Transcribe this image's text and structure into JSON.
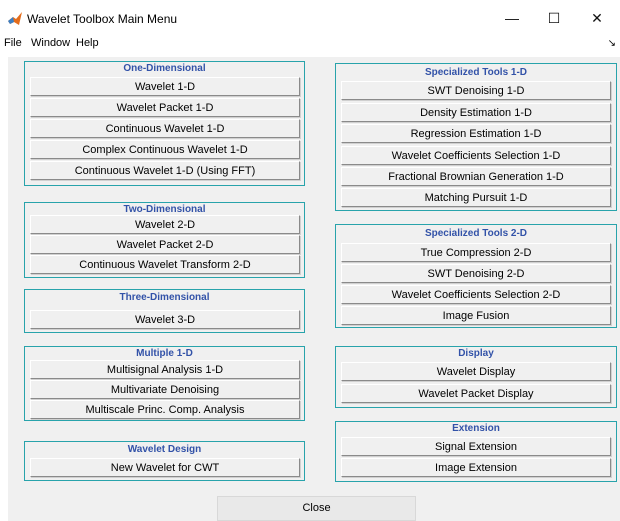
{
  "window": {
    "title": "Wavelet Toolbox Main Menu",
    "minimize_glyph": "—",
    "maximize_glyph": "☐",
    "close_glyph": "✕"
  },
  "menu": {
    "file": "File",
    "window": "Window",
    "help": "Help",
    "overflow_glyph": "↘"
  },
  "panels": {
    "one_dim": {
      "title": "One-Dimensional",
      "buttons": [
        "Wavelet 1-D",
        "Wavelet Packet 1-D",
        "Continuous Wavelet 1-D",
        "Complex Continuous Wavelet 1-D",
        "Continuous Wavelet 1-D (Using FFT)"
      ]
    },
    "two_dim": {
      "title": "Two-Dimensional",
      "buttons": [
        "Wavelet 2-D",
        "Wavelet Packet 2-D",
        "Continuous Wavelet Transform 2-D"
      ]
    },
    "three_dim": {
      "title": "Three-Dimensional",
      "buttons": [
        "Wavelet 3-D"
      ]
    },
    "multiple_1d": {
      "title": "Multiple 1-D",
      "buttons": [
        "Multisignal Analysis 1-D",
        "Multivariate Denoising",
        "Multiscale Princ. Comp. Analysis"
      ]
    },
    "wavelet_design": {
      "title": "Wavelet Design",
      "buttons": [
        "New Wavelet for CWT"
      ]
    },
    "spec_1d": {
      "title": "Specialized Tools 1-D",
      "buttons": [
        "SWT Denoising 1-D",
        "Density Estimation 1-D",
        "Regression Estimation 1-D",
        "Wavelet Coefficients Selection 1-D",
        "Fractional Brownian Generation 1-D",
        "Matching Pursuit 1-D"
      ]
    },
    "spec_2d": {
      "title": "Specialized Tools 2-D",
      "buttons": [
        "True Compression 2-D",
        "SWT Denoising 2-D",
        "Wavelet Coefficients Selection 2-D",
        "Image Fusion"
      ]
    },
    "display": {
      "title": "Display",
      "buttons": [
        "Wavelet Display",
        "Wavelet Packet Display"
      ]
    },
    "extension": {
      "title": "Extension",
      "buttons": [
        "Signal Extension",
        "Image Extension"
      ]
    }
  },
  "close_label": "Close",
  "colors": {
    "panel_border": "#28a3ab",
    "panel_title": "#3252a8",
    "background": "#f0f0f0"
  }
}
